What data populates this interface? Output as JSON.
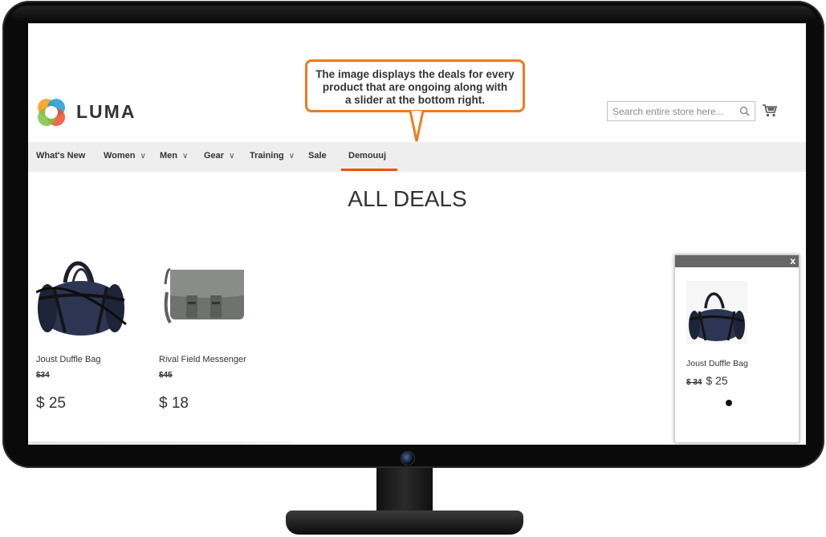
{
  "header": {
    "logo_text": "LUMA",
    "search_placeholder": "Search entire store here...",
    "icons": {
      "search": "search-icon",
      "cart": "cart-icon",
      "logo": "luma-logo-icon"
    }
  },
  "callout": {
    "line1": "The image displays the deals for every",
    "line2": "product that are ongoing along with",
    "line3": "a slider at the bottom right."
  },
  "nav": {
    "items": [
      {
        "label": "What's New"
      },
      {
        "label": "Women"
      },
      {
        "label": "Men"
      },
      {
        "label": "Gear"
      },
      {
        "label": "Training"
      },
      {
        "label": "Sale"
      },
      {
        "label": "Demouuj"
      }
    ],
    "chevron": "∨"
  },
  "page_title": "ALL DEALS",
  "products": [
    {
      "name": "Joust Duffle Bag",
      "old_price": "$34",
      "price": "$ 25",
      "image": "duffle-bag"
    },
    {
      "name": "Rival Field Messenger",
      "old_price": "$45",
      "price": "$ 18",
      "image": "messenger-bag"
    }
  ],
  "slider": {
    "close_label": "x",
    "product_name": "Joust Duffle Bag",
    "old_price": "$ 34",
    "price": "$ 25"
  },
  "colors": {
    "accent": "#eb5202",
    "callout_border": "#f07a1f",
    "nav_bg": "#eeeeee",
    "slider_header": "#666666"
  }
}
